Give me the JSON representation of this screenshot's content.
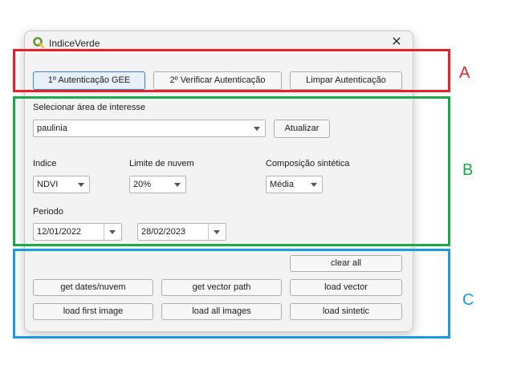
{
  "window": {
    "title": "IndiceVerde",
    "close_glyph": "✕"
  },
  "auth": {
    "btn_auth": "1º Autenticação GEE",
    "btn_verify": "2º Verificar Autenticação",
    "btn_clear": "Limpar Autenticação"
  },
  "area": {
    "label": "Selecionar área de interesse",
    "selected": "paulinia",
    "refresh_btn": "Atualizar"
  },
  "params": {
    "indice_label": "Indice",
    "indice_value": "NDVI",
    "cloud_label": "Limite de nuvem",
    "cloud_value": "20%",
    "comp_label": "Composição sintética",
    "comp_value": "Média"
  },
  "period": {
    "label": "Periodo",
    "start": "12/01/2022",
    "end": "28/02/2023"
  },
  "actions": {
    "clear_all": "clear all",
    "get_dates": "get dates/nuvem",
    "get_vector_path": "get vector path",
    "load_vector": "load vector",
    "load_first_image": "load first image",
    "load_all_images": "load all images",
    "load_sintetic": "load sintetic"
  },
  "annotations": {
    "a_label": "A",
    "a_color": "#e8212b",
    "b_label": "B",
    "b_color": "#1aaa4a",
    "c_label": "C",
    "c_color": "#1a9ae0"
  },
  "icons": {
    "app_icon": "qgis-logo-icon",
    "close_icon": "close-icon",
    "dropdown_icon": "chevron-down-icon"
  }
}
